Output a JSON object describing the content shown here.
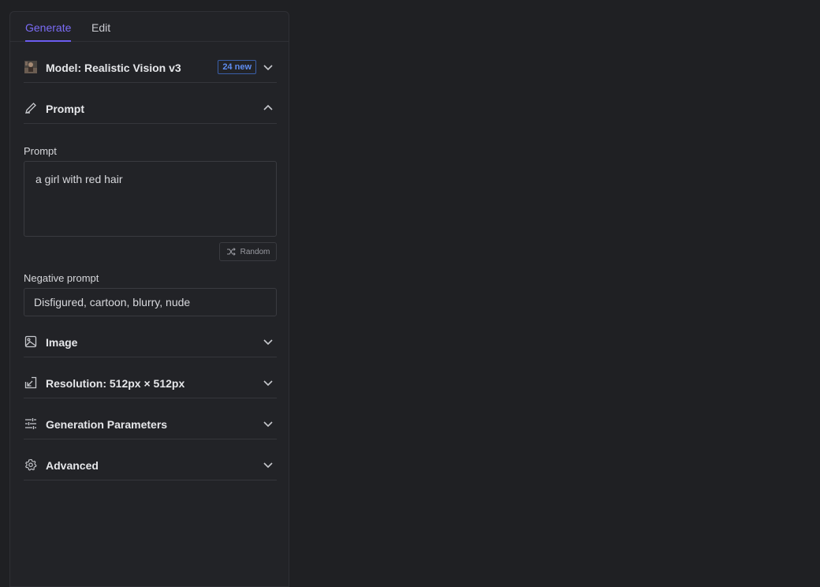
{
  "tabs": [
    {
      "label": "Generate",
      "active": true
    },
    {
      "label": "Edit",
      "active": false
    }
  ],
  "model": {
    "title": "Model: Realistic Vision v3",
    "badge": "24 new",
    "icon": "model-thumbnail"
  },
  "prompt_section": {
    "title": "Prompt",
    "icon": "pencil-icon",
    "expanded": true
  },
  "prompt": {
    "label": "Prompt",
    "value": "a girl with red hair",
    "random_label": "Random"
  },
  "negative_prompt": {
    "label": "Negative prompt",
    "value": "Disfigured, cartoon, blurry, nude"
  },
  "sections": {
    "image": {
      "title": "Image",
      "icon": "image-icon"
    },
    "resolution": {
      "title": "Resolution: 512px × 512px",
      "icon": "resize-icon"
    },
    "generation": {
      "title": "Generation Parameters",
      "icon": "sliders-icon"
    },
    "advanced": {
      "title": "Advanced",
      "icon": "gear-icon"
    }
  },
  "colors": {
    "accent": "#6b5cf0",
    "badge": "#5f8df0",
    "background": "#1f2023",
    "panel": "#222327"
  }
}
